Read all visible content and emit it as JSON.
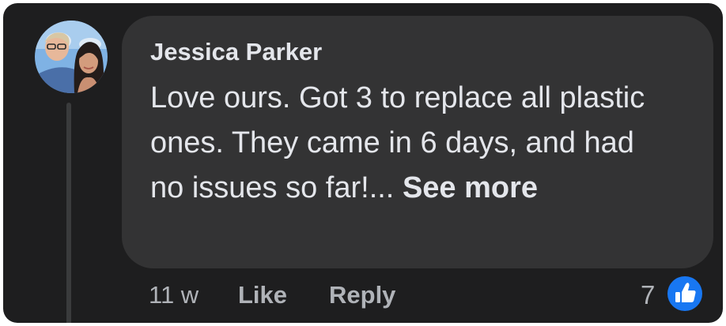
{
  "comment": {
    "author": "Jessica Parker",
    "text": "Love ours. Got 3 to replace all plastic ones. They came in 6 days, and had no issues so far!...",
    "see_more_label": "See more",
    "time": "11 w",
    "like_label": "Like",
    "reply_label": "Reply",
    "reaction_count": "7",
    "reaction_icon": "thumbs-up-icon"
  },
  "colors": {
    "background": "#1e1e1f",
    "bubble": "#333334",
    "text_primary": "#e4e6eb",
    "text_secondary": "#b0b3b8",
    "like_blue": "#1877f2"
  }
}
